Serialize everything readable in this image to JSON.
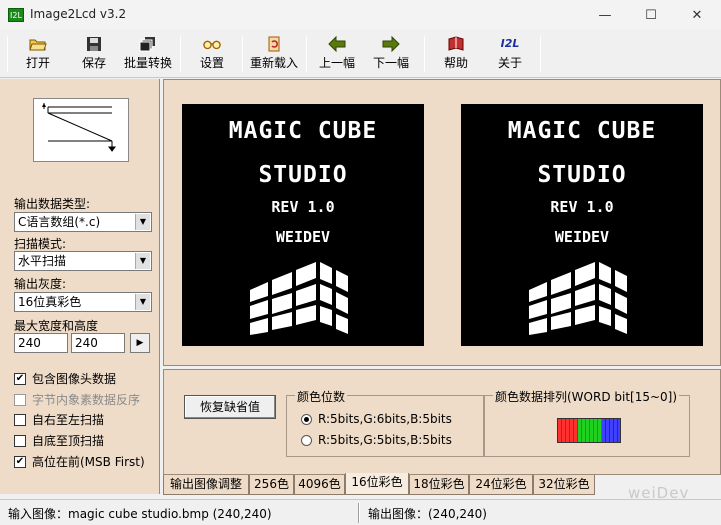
{
  "window": {
    "title": "Image2Lcd v3.2",
    "app_icon_text": "I2L",
    "controls": {
      "minimize": "—",
      "maximize": "☐",
      "close": "✕"
    }
  },
  "toolbar": {
    "items": [
      {
        "label": "打开",
        "icon": "open-folder-icon"
      },
      {
        "label": "保存",
        "icon": "floppy-disk-icon"
      },
      {
        "label": "批量转换",
        "icon": "batch-convert-icon"
      },
      {
        "label": "设置",
        "icon": "settings-glasses-icon"
      },
      {
        "label": "重新载入",
        "icon": "reload-icon"
      },
      {
        "label": "上一幅",
        "icon": "arrow-left-icon"
      },
      {
        "label": "下一幅",
        "icon": "arrow-right-icon"
      },
      {
        "label": "帮助",
        "icon": "help-book-icon"
      },
      {
        "label": "关于",
        "icon": "about-i2l-icon"
      }
    ],
    "about_icon_text": "I2L"
  },
  "left": {
    "output_type_label": "输出数据类型:",
    "output_type_value": "C语言数组(*.c)",
    "scan_mode_label": "扫描模式:",
    "scan_mode_value": "水平扫描",
    "gray_label": "输出灰度:",
    "gray_value": "16位真彩色",
    "maxsize_label": "最大宽度和高度",
    "max_width": "240",
    "max_height": "240",
    "arrow_button": "▶",
    "options": [
      {
        "label": "包含图像头数据",
        "checked": true,
        "disabled": false
      },
      {
        "label": "字节内象素数据反序",
        "checked": false,
        "disabled": true
      },
      {
        "label": "自右至左扫描",
        "checked": false,
        "disabled": false
      },
      {
        "label": "自底至顶扫描",
        "checked": false,
        "disabled": false
      },
      {
        "label": "高位在前(MSB First)",
        "checked": true,
        "disabled": false
      }
    ]
  },
  "images": {
    "line1": "MAGIC CUBE",
    "line2": "STUDIO",
    "line3": "REV 1.0",
    "line4": "WEIDEV"
  },
  "controls": {
    "restore_button": "恢复缺省值",
    "color_bits_title": "颜色位数",
    "radio_options": [
      {
        "label": "R:5bits,G:6bits,B:5bits",
        "selected": true
      },
      {
        "label": "R:5bits,G:5bits,B:5bits",
        "selected": false
      }
    ],
    "color_order_title": "颜色数据排列(WORD bit[15~0])",
    "bit_colors": {
      "red": "#ff3030",
      "green": "#20d020",
      "blue": "#4040ff"
    }
  },
  "tabs": [
    {
      "label": "输出图像调整",
      "active": false
    },
    {
      "label": "256色",
      "active": false
    },
    {
      "label": "4096色",
      "active": false
    },
    {
      "label": "16位彩色",
      "active": true
    },
    {
      "label": "18位彩色",
      "active": false
    },
    {
      "label": "24位彩色",
      "active": false
    },
    {
      "label": "32位彩色",
      "active": false
    }
  ],
  "status": {
    "input": "输入图像：magic cube studio.bmp (240,240)",
    "output": "输出图像：(240,240)"
  },
  "watermark": "weiDev"
}
